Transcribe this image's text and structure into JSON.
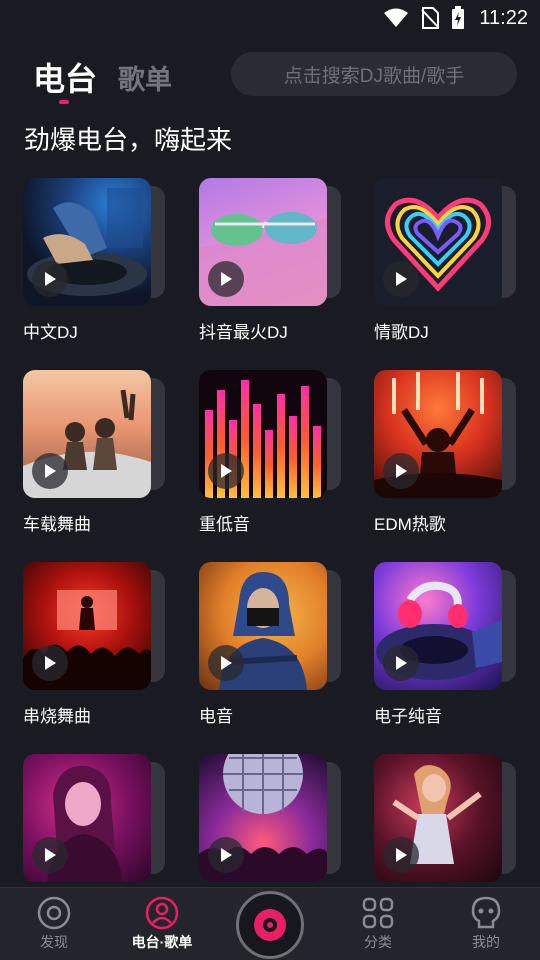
{
  "status_bar": {
    "time": "11:22",
    "icons": [
      "wifi-icon",
      "no-sim-icon",
      "battery-charging-icon"
    ]
  },
  "header": {
    "active_tab": "电台",
    "inactive_tab": "歌单",
    "search_placeholder": "点击搜索DJ歌曲/歌手"
  },
  "section_title": "劲爆电台，嗨起来",
  "stations": [
    {
      "label": "中文DJ",
      "icon": "play-icon"
    },
    {
      "label": "抖音最火DJ",
      "icon": "play-icon"
    },
    {
      "label": "情歌DJ",
      "icon": "play-icon"
    },
    {
      "label": "车载舞曲",
      "icon": "play-icon"
    },
    {
      "label": "重低音",
      "icon": "play-icon"
    },
    {
      "label": "EDM热歌",
      "icon": "play-icon"
    },
    {
      "label": "串烧舞曲",
      "icon": "play-icon"
    },
    {
      "label": "电音",
      "icon": "play-icon"
    },
    {
      "label": "电子纯音",
      "icon": "play-icon"
    },
    {
      "label": "",
      "icon": "play-icon"
    },
    {
      "label": "",
      "icon": "play-icon"
    },
    {
      "label": "",
      "icon": "play-icon"
    }
  ],
  "bottom_nav": {
    "items": [
      {
        "label": "发现",
        "icon": "discover-icon"
      },
      {
        "label": "电台·歌单",
        "icon": "radio-icon"
      },
      {
        "label": "",
        "icon": "vinyl-player-icon"
      },
      {
        "label": "分类",
        "icon": "grid-icon"
      },
      {
        "label": "我的",
        "icon": "profile-icon"
      }
    ]
  },
  "colors": {
    "background": "#1a1b22",
    "accent": "#e91e63",
    "muted_text": "#74757c",
    "search_bg": "#2a2b33",
    "nav_bg": "#24252c"
  }
}
